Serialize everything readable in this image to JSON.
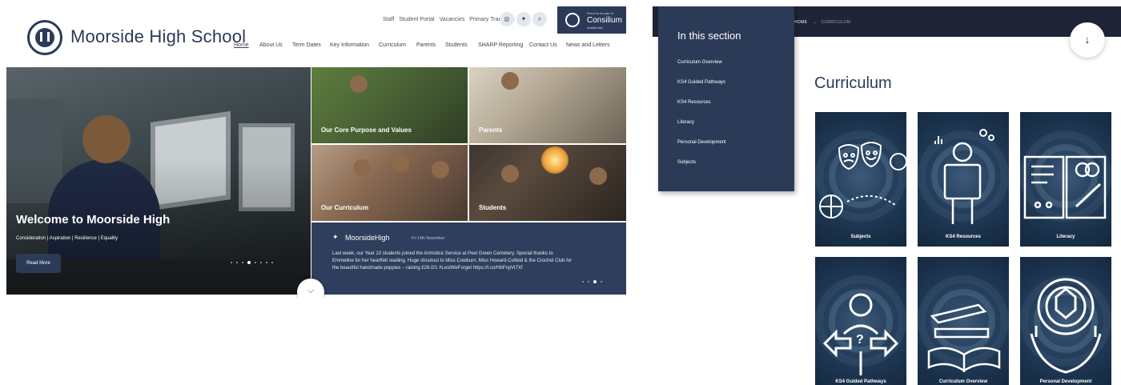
{
  "home": {
    "site_name": "Moorside High School",
    "utility_links": [
      "Staff",
      "Student Portal",
      "Vacancies",
      "Primary Transition"
    ],
    "utility_icons": [
      "instagram-icon",
      "twitter-icon",
      "search-icon"
    ],
    "consilium": {
      "small": "Proud to be part of",
      "name": "Consilium",
      "sub": "Academies"
    },
    "nav": [
      "Home",
      "About Us",
      "Term Dates",
      "Key Information",
      "Curriculum",
      "Parents",
      "Students",
      "SHARP Reporting",
      "Contact Us",
      "News and Letters"
    ],
    "hero": {
      "title": "Welcome to Moorside High",
      "subtitle": "Consideration | Aspiration | Resilience | Equality",
      "button": "Read More"
    },
    "tiles": [
      "Our Core Purpose and Values",
      "Parents",
      "Our Curriculum",
      "Students"
    ],
    "tweet": {
      "handle": "MoorsideHigh",
      "date": "Fri 14th November",
      "text": "Last week, our Year 10 students joined the Armistice Service at Peel Green Cemetery. Special thanks to Emmeline for her heartfelt reading. Huge shoutout to Miss Cowburn, Miss Howard-Cofield & the Crochet Club for the beautiful handmade poppies – raising £26.0/1 #LestWeForget https://t.co/HbFnpVt7Xf"
    }
  },
  "curriculum": {
    "breadcrumb": [
      "HOME",
      "CURRICULUM"
    ],
    "breadcrumb_arrow": "→",
    "scroll_icon": "↓",
    "section_title": "In this section",
    "section_items": [
      "Curriculum Overview",
      "KS4 Guided Pathways",
      "KS4 Resources",
      "Literacy",
      "Personal Development",
      "Subjects"
    ],
    "page_title": "Curriculum",
    "cards": [
      "Subjects",
      "KS4 Resources",
      "Literacy",
      "KS4 Guided Pathways",
      "Curriculum Overview",
      "Personal Development"
    ]
  },
  "colors": {
    "navy": "#2b3a57",
    "dark_bar": "#1f2436",
    "card_blue": "#1e3753"
  }
}
